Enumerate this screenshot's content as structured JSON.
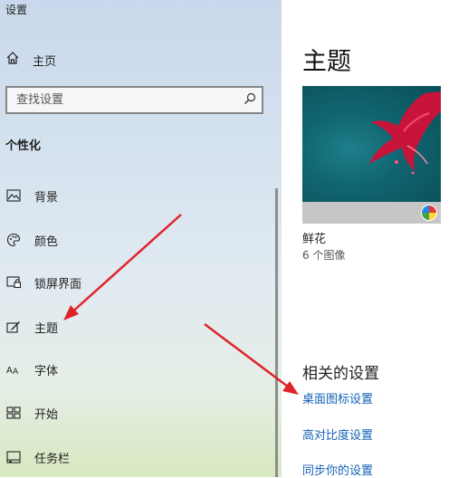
{
  "window": {
    "title": "设置"
  },
  "sidebar": {
    "home_label": "主页",
    "search_placeholder": "查找设置",
    "section_title": "个性化",
    "items": [
      {
        "label": "背景",
        "icon": "picture-icon"
      },
      {
        "label": "颜色",
        "icon": "palette-icon"
      },
      {
        "label": "锁屏界面",
        "icon": "lock-screen-icon"
      },
      {
        "label": "主题",
        "icon": "theme-brush-icon"
      },
      {
        "label": "字体",
        "icon": "font-icon"
      },
      {
        "label": "开始",
        "icon": "start-grid-icon"
      },
      {
        "label": "任务栏",
        "icon": "taskbar-icon"
      }
    ]
  },
  "main": {
    "title": "主题",
    "theme": {
      "name": "鲜花",
      "count": "6 个图像"
    },
    "related_title": "相关的设置",
    "links": [
      "桌面图标设置",
      "高对比度设置",
      "同步你的设置"
    ]
  },
  "colors": {
    "accent_link": "#1462b6",
    "arrow": "#e0232b"
  }
}
